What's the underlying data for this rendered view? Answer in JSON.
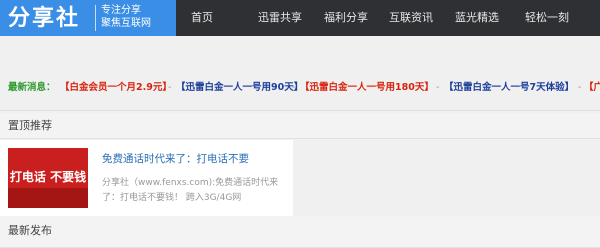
{
  "logo": {
    "name": "分享社",
    "tagline_1": "专注分享",
    "tagline_2": "聚焦互联网"
  },
  "nav": {
    "items": [
      "首页",
      "迅雷共享",
      "福利分享",
      "互联资讯",
      "蓝光精选",
      "轻松一刻"
    ]
  },
  "ticker": {
    "label": "最新消息：",
    "items": [
      {
        "text": "【白金会员一个月2.9元】",
        "color": "#d9230f"
      },
      {
        "text": "【迅雷白金一人一号用90天】",
        "color": "#1d3f9b"
      },
      {
        "text": "【迅雷白金一人一号用180天】",
        "color": "#d9230f"
      },
      {
        "text": "【迅雷白金一人一号7天体验】",
        "color": "#1d3f9b"
      },
      {
        "text": "【广",
        "color": "#d9230f"
      }
    ],
    "separator": "-"
  },
  "pinned": {
    "heading": "置顶推荐",
    "card": {
      "thumb_text": "打电话 不要钱",
      "title": "免费通话时代来了：打电话不要",
      "desc": "分享社（www.fenxs.com):免费通话时代来了：打电话不要钱！ 跨入3G/4G网"
    }
  },
  "latest": {
    "heading": "最新发布"
  }
}
